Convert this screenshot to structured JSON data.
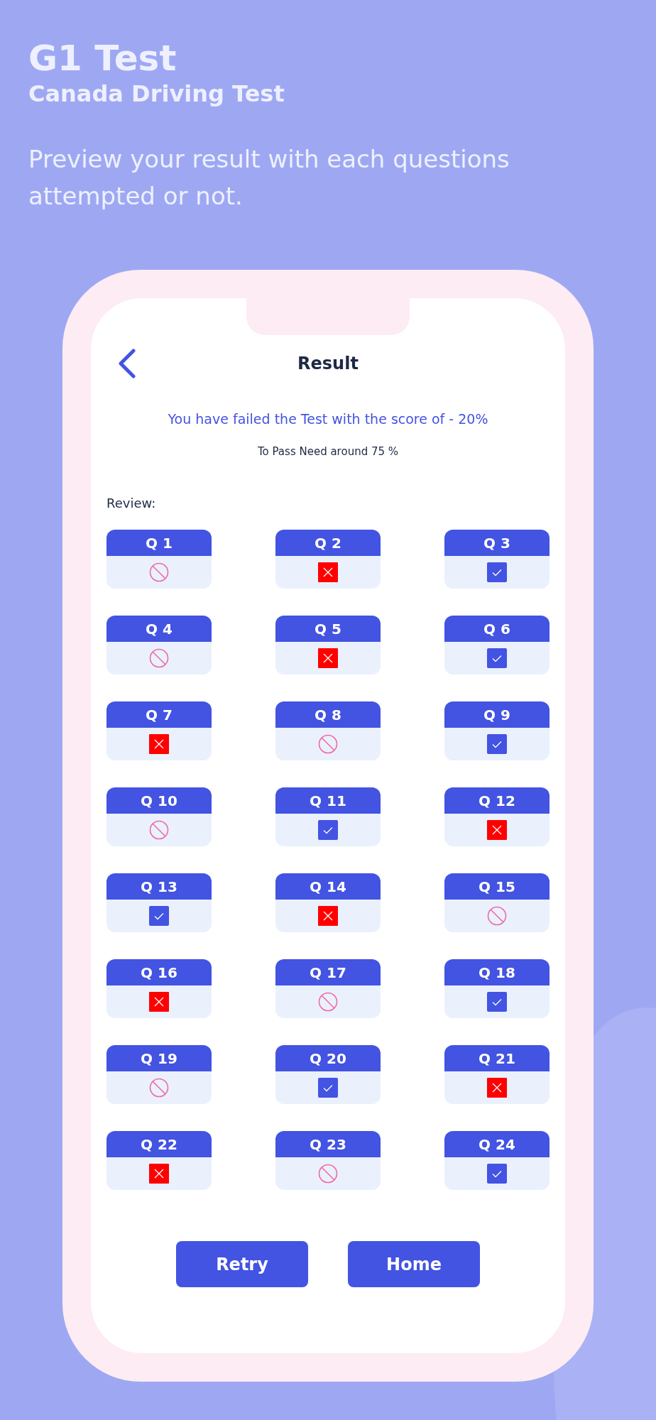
{
  "header": {
    "title": "G1 Test",
    "subtitle": "Canada Driving Test",
    "description": "Preview your result with each questions attempted or not."
  },
  "screen": {
    "title": "Result",
    "result_message": "You have failed the Test with the score of - 20%",
    "pass_requirement": "To Pass Need around 75 %",
    "review_label": "Review:",
    "questions": [
      {
        "label": "Q 1",
        "kind": "skipped"
      },
      {
        "label": "Q 2",
        "kind": "wrong"
      },
      {
        "label": "Q 3",
        "kind": "correct"
      },
      {
        "label": "Q 4",
        "kind": "skipped"
      },
      {
        "label": "Q 5",
        "kind": "wrong"
      },
      {
        "label": "Q 6",
        "kind": "correct"
      },
      {
        "label": "Q 7",
        "kind": "wrong"
      },
      {
        "label": "Q 8",
        "kind": "skipped"
      },
      {
        "label": "Q 9",
        "kind": "correct"
      },
      {
        "label": "Q 10",
        "kind": "skipped"
      },
      {
        "label": "Q 11",
        "kind": "correct"
      },
      {
        "label": "Q 12",
        "kind": "wrong"
      },
      {
        "label": "Q 13",
        "kind": "correct"
      },
      {
        "label": "Q 14",
        "kind": "wrong"
      },
      {
        "label": "Q 15",
        "kind": "skipped"
      },
      {
        "label": "Q 16",
        "kind": "wrong"
      },
      {
        "label": "Q 17",
        "kind": "skipped"
      },
      {
        "label": "Q 18",
        "kind": "correct"
      },
      {
        "label": "Q 19",
        "kind": "skipped"
      },
      {
        "label": "Q 20",
        "kind": "correct"
      },
      {
        "label": "Q 21",
        "kind": "wrong"
      },
      {
        "label": "Q 22",
        "kind": "wrong"
      },
      {
        "label": "Q 23",
        "kind": "skipped"
      },
      {
        "label": "Q 24",
        "kind": "correct"
      }
    ],
    "buttons": [
      "Retry",
      "Home"
    ]
  }
}
